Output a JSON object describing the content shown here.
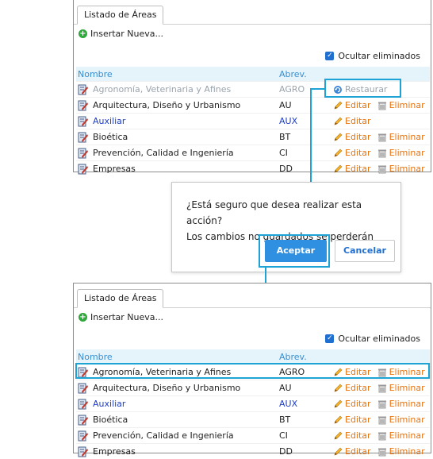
{
  "top": {
    "tab_label": "Listado de Áreas",
    "insert_label": "Insertar Nueva...",
    "hide_deleted_label": "Ocultar eliminados",
    "columns": [
      "Nombre",
      "Abrev."
    ],
    "rows": [
      {
        "name": "Agronomía, Veterinaria y Afines",
        "abrev": "AGRO",
        "action1": "Restaurar"
      },
      {
        "name": "Arquitectura, Diseño y Urbanismo",
        "abrev": "AU",
        "action1": "Editar",
        "action2": "Eliminar"
      },
      {
        "name": "Auxiliar",
        "abrev": "AUX",
        "action1": "Editar"
      },
      {
        "name": "Bioética",
        "abrev": "BT",
        "action1": "Editar",
        "action2": "Eliminar"
      },
      {
        "name": "Prevención, Calidad e Ingeniería",
        "abrev": "CI",
        "action1": "Editar",
        "action2": "Eliminar"
      },
      {
        "name": "Empresas",
        "abrev": "DD",
        "action1": "Editar",
        "action2": "Eliminar"
      }
    ]
  },
  "dialog": {
    "line1": "¿Está seguro que desea realizar esta acción?",
    "line2": "Los cambios no guardados se perderán",
    "accept_label": "Aceptar",
    "cancel_label": "Cancelar"
  },
  "bottom": {
    "tab_label": "Listado de Áreas",
    "insert_label": "Insertar Nueva...",
    "hide_deleted_label": "Ocultar eliminados",
    "columns": [
      "Nombre",
      "Abrev."
    ],
    "rows": [
      {
        "name": "Agronomía, Veterinaria y Afines",
        "abrev": "AGRO",
        "action1": "Editar",
        "action2": "Eliminar"
      },
      {
        "name": "Arquitectura, Diseño y Urbanismo",
        "abrev": "AU",
        "action1": "Editar",
        "action2": "Eliminar"
      },
      {
        "name": "Auxiliar",
        "abrev": "AUX",
        "action1": "Editar",
        "action2": "Eliminar"
      },
      {
        "name": "Bioética",
        "abrev": "BT",
        "action1": "Editar",
        "action2": "Eliminar"
      },
      {
        "name": "Prevención, Calidad e Ingeniería",
        "abrev": "CI",
        "action1": "Editar",
        "action2": "Eliminar"
      },
      {
        "name": "Empresas",
        "abrev": "DD",
        "action1": "Editar",
        "action2": "Eliminar"
      }
    ]
  },
  "colors": {
    "accent": "#1ea4d4",
    "action": "#e8730c",
    "primary_button": "#2f8fe0"
  }
}
